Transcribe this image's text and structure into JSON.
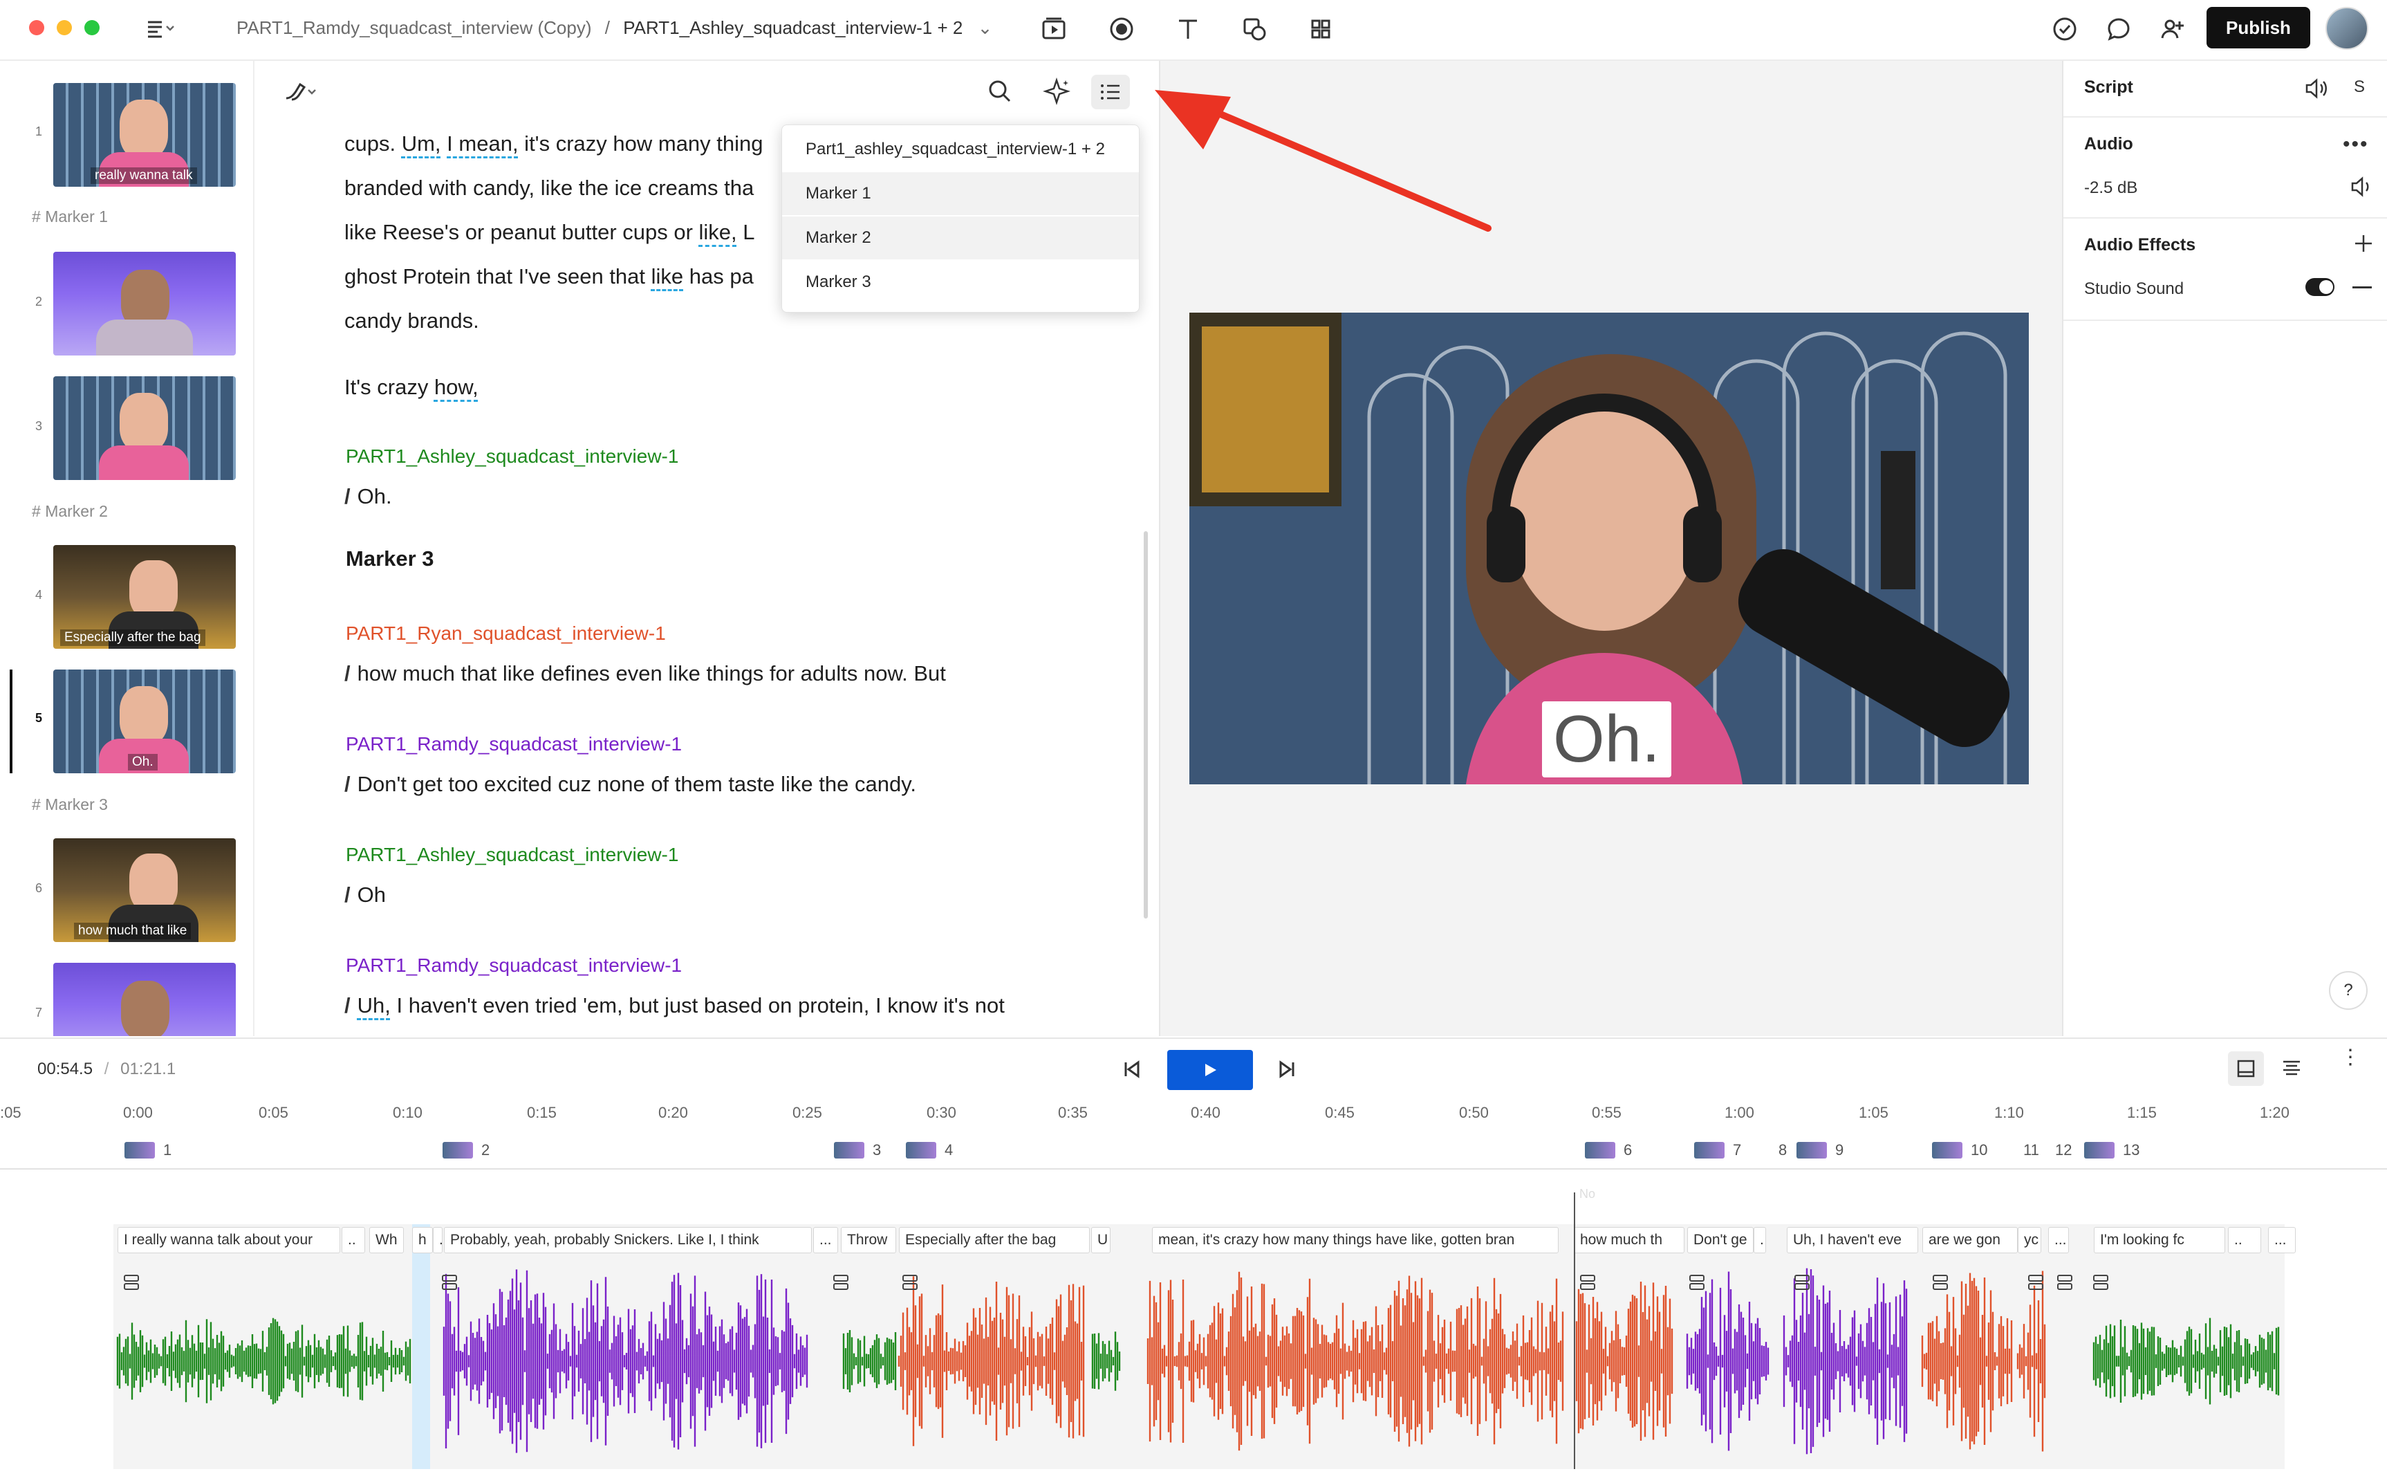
{
  "breadcrumb": {
    "parent": "PART1_Ramdy_squadcast_interview (Copy)",
    "separator": "/",
    "current": "PART1_Ashley_squadcast_interview-1 + 2"
  },
  "topbar": {
    "publish_label": "Publish"
  },
  "sidebar": {
    "scenes": [
      {
        "num": "1",
        "caption": "really wanna talk",
        "style": "wall"
      },
      {
        "num": "2",
        "caption": "",
        "style": "blue"
      },
      {
        "num": "3",
        "caption": "",
        "style": "wall"
      },
      {
        "num": "4",
        "caption": "Especially after the bag",
        "style": "room"
      },
      {
        "num": "5",
        "caption": "Oh.",
        "style": "wall"
      },
      {
        "num": "6",
        "caption": "how much that like",
        "style": "room"
      },
      {
        "num": "7",
        "caption": "",
        "style": "blue"
      }
    ],
    "markers": [
      "Marker 1",
      "Marker 2",
      "Marker 3"
    ]
  },
  "script": {
    "lines": [
      [
        "cups. ",
        "Um,",
        " ",
        "I mean,",
        " it's crazy how many thing"
      ],
      [
        "branded with candy, like the ice creams tha"
      ],
      [
        "like Reese's or peanut butter cups or ",
        "like,",
        " L"
      ],
      [
        "ghost Protein that I've seen that ",
        "like",
        " has pa"
      ],
      [
        "candy brands."
      ]
    ],
    "crazy_line": [
      "It's crazy ",
      "how,"
    ],
    "blocks": [
      {
        "speaker": "PART1_Ashley_squadcast_interview-1",
        "color": "#1e8a1e",
        "text": "Oh."
      },
      {
        "speaker": "PART1_Ryan_squadcast_interview-1",
        "color": "#e0522b",
        "text": "how much that like defines even like things for adults now. But"
      },
      {
        "speaker": "PART1_Ramdy_squadcast_interview-1",
        "color": "#7a22c9",
        "text": "Don't get too excited cuz none of them taste like the candy."
      },
      {
        "speaker": "PART1_Ashley_squadcast_interview-1",
        "color": "#1e8a1e",
        "text": "Oh"
      },
      {
        "speaker": "PART1_Ramdy_squadcast_interview-1",
        "color": "#7a22c9",
        "text_filler": "Uh,",
        "text": " I haven't even tried 'em, but just based on protein, I know it's not"
      }
    ],
    "marker_heading": "Marker 3"
  },
  "dropdown": {
    "items": [
      "Part1_ashley_squadcast_interview-1 + 2",
      "Marker 1",
      "Marker 2",
      "Marker 3"
    ]
  },
  "video": {
    "caption": "Oh."
  },
  "rightpanel": {
    "script_label": "Script",
    "s_label": "S",
    "audio_label": "Audio",
    "volume": "-2.5 dB",
    "effects_label": "Audio Effects",
    "studio_sound": "Studio Sound",
    "studio_sound_on": true,
    "help": "?"
  },
  "transport": {
    "current": "00:54.5",
    "separator": "/",
    "total": "01:21.1"
  },
  "timeline": {
    "ticks": [
      ":05",
      "0:00",
      "0:05",
      "0:10",
      "0:15",
      "0:20",
      "0:25",
      "0:30",
      "0:35",
      "0:40",
      "0:45",
      "0:50",
      "0:55",
      "1:00",
      "1:05",
      "1:10",
      "1:15",
      "1:20"
    ],
    "scene_tags": [
      "1",
      "2",
      "3",
      "4",
      "6",
      "7",
      "8",
      "9",
      "10",
      "11",
      "12",
      "13"
    ],
    "clips": [
      "I really wanna talk about your",
      "..",
      "Wh",
      "h",
      ".",
      "Probably, yeah, probably Snickers. Like I, I think",
      "...",
      "Throw",
      "Especially after the bag",
      "U",
      "mean, it's crazy how many things have like, gotten bran",
      "how much th",
      "Don't ge",
      ".",
      "Uh, I haven't eve",
      "are we gon",
      "yc",
      "...",
      "I'm looking fc",
      "..",
      "..."
    ],
    "ghost_label": "No"
  },
  "colors": {
    "ashley": "#1e8a1e",
    "ryan": "#e0522b",
    "ramdy": "#7a22c9",
    "annotation_arrow": "#ea3323",
    "play_button": "#0a5bd9"
  }
}
